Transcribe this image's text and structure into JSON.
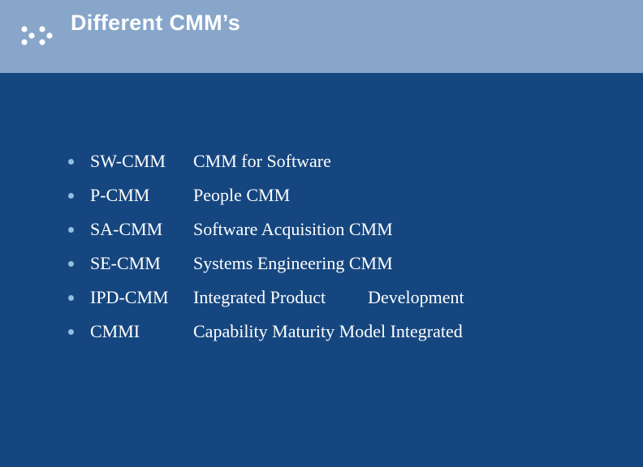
{
  "header": {
    "title": "Different CMM’s",
    "logo_icon": "dots-cluster-icon"
  },
  "colors": {
    "header_bg": "#87a6c9",
    "body_bg": "#15467f",
    "bullet": "#8fc0dc",
    "text": "#ffffff"
  },
  "items": [
    {
      "abbr": "SW-CMM",
      "desc": "CMM for Software"
    },
    {
      "abbr": "P-CMM",
      "desc": "People CMM"
    },
    {
      "abbr": "SA-CMM",
      "desc": "Software Acquisition CMM"
    },
    {
      "abbr": "SE-CMM",
      "desc": "Systems Engineering CMM"
    },
    {
      "abbr": "IPD-CMM",
      "desc_part1": "Integrated Product",
      "desc_part2": "Development"
    },
    {
      "abbr": "CMMI",
      "desc": "Capability Maturity Model Integrated"
    }
  ]
}
